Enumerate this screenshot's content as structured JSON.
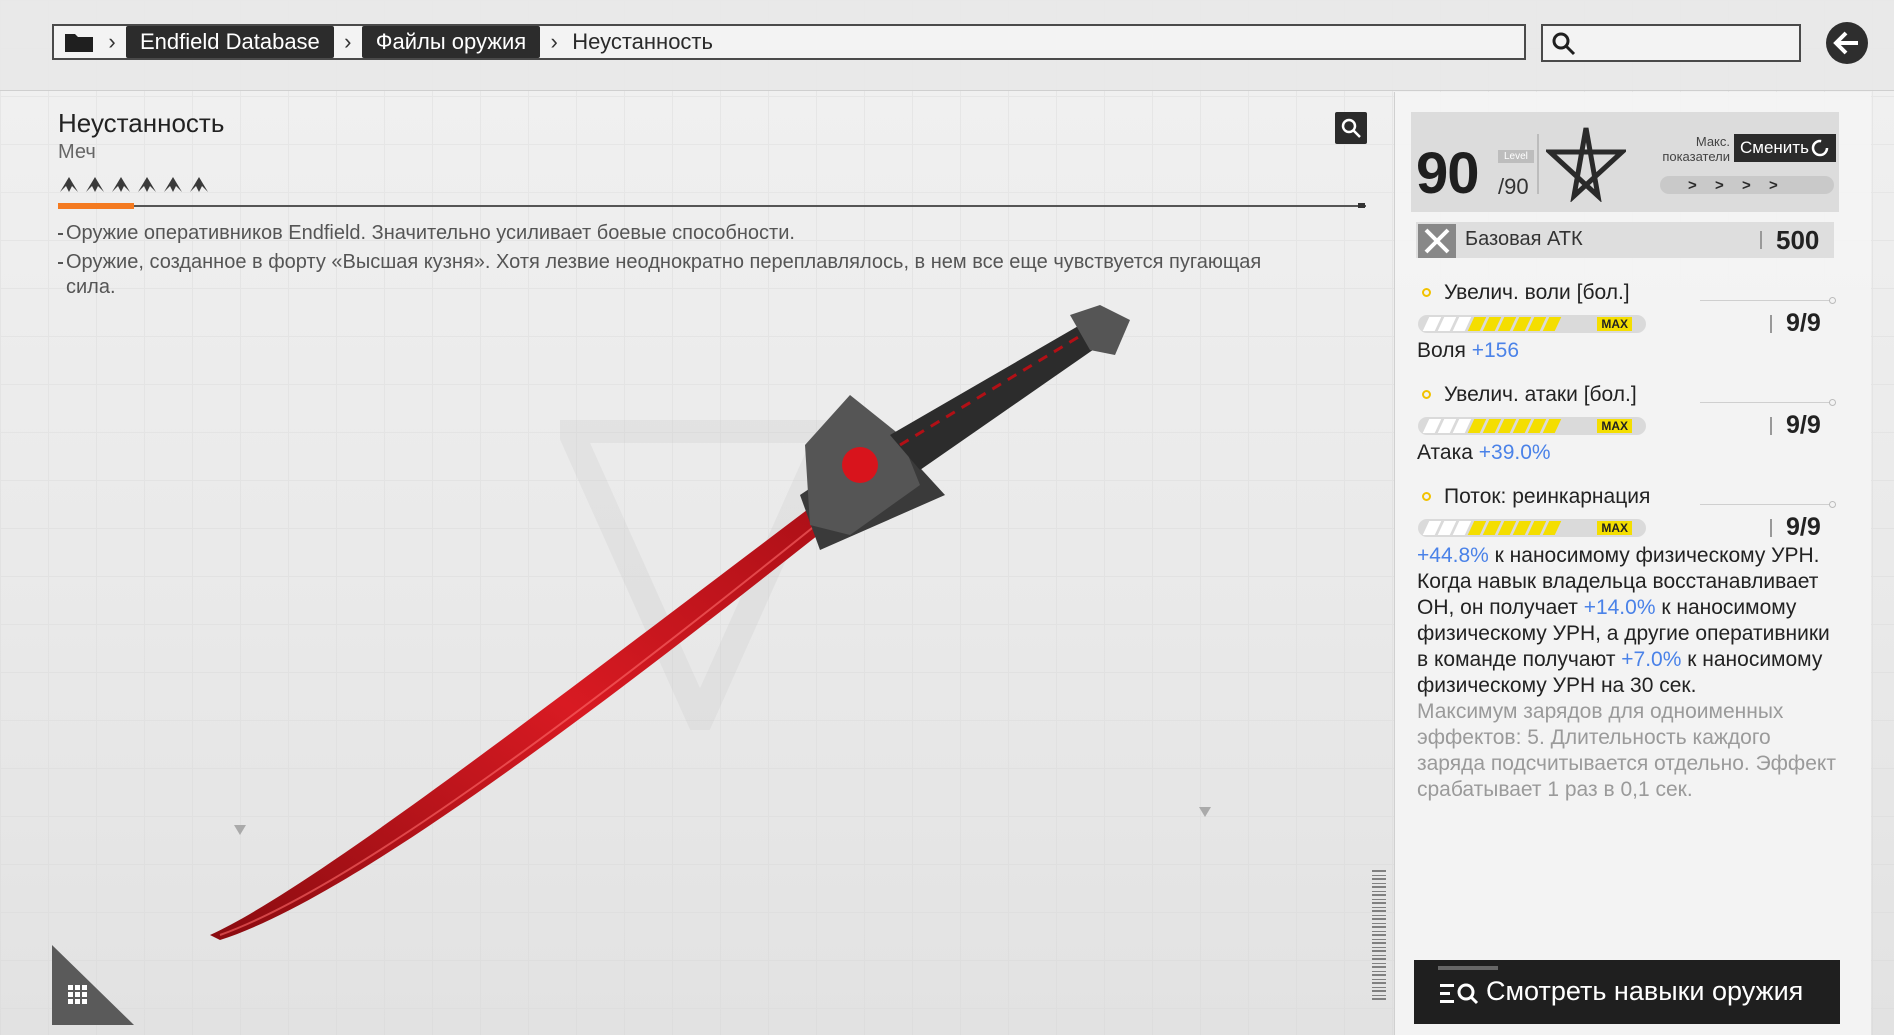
{
  "breadcrumb": {
    "items": [
      "Endfield Database",
      "Файлы оружия"
    ],
    "current": "Неустанность"
  },
  "weapon": {
    "name": "Неустанность",
    "type": "Меч",
    "rarity": 6,
    "descriptions": [
      "Оружие оперативников Endfield. Значительно усиливает боевые способности.",
      "Оружие, созданное в форту «Высшая кузня». Хотя лезвие неоднократно переплавлялось, в нем все еще чувствуется пугающая сила."
    ]
  },
  "stats": {
    "level": "90",
    "level_max": "/90",
    "level_tag": "Level",
    "max_label": "Макс. показатели",
    "switch_label": "Сменить",
    "base_atk_label": "Базовая АТК",
    "base_atk_value": "500"
  },
  "skills": [
    {
      "name": "Увелич. воли [бол.]",
      "level": "9/9",
      "max_tag": "MAX",
      "progress": 1.0,
      "stat_label": "Воля",
      "stat_value": "+156"
    },
    {
      "name": "Увелич. атаки [бол.]",
      "level": "9/9",
      "max_tag": "MAX",
      "progress": 1.0,
      "stat_label": "Атака",
      "stat_value": "+39.0%"
    },
    {
      "name": "Поток: реинкарнация",
      "level": "9/9",
      "max_tag": "MAX",
      "progress": 1.0
    }
  ],
  "skill3_desc": {
    "v1": "+44.8%",
    "t1": " к наносимому физическому УРН.",
    "t2": "Когда навык владельца восстанавливает ОН, он получает ",
    "v2": "+14.0%",
    "t3": " к наносимому физическому УРН, а другие оперативники в команде получают ",
    "v3": "+7.0%",
    "t4": " к наносимому физическому УРН на 30 сек.",
    "note": "Максимум зарядов для одноименных эффектов: 5. Длительность каждого заряда подсчитывается отдельно. Эффект срабатывает 1 раз в 0,1 сек."
  },
  "actions": {
    "view_skills": "Смотреть навыки оружия"
  },
  "colors": {
    "accent_orange": "#f47a20",
    "max_yellow": "#f4de00",
    "value_blue": "#4a82e8",
    "blade_red": "#c4121a"
  },
  "icons": {
    "folder": "folder-icon",
    "search": "search-icon",
    "back": "back-arrow-icon",
    "zoom": "zoom-icon",
    "emblem": "pentagram-emblem-icon",
    "atk": "crossed-swords-icon",
    "view": "list-search-icon",
    "grid": "grid-icon"
  }
}
